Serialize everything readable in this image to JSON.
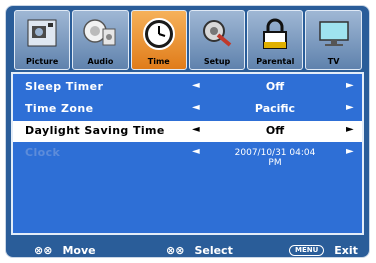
{
  "tabs": [
    {
      "label": "Picture",
      "icon": "picture-icon",
      "active": false
    },
    {
      "label": "Audio",
      "icon": "audio-icon",
      "active": false
    },
    {
      "label": "Time",
      "icon": "clock-icon",
      "active": true
    },
    {
      "label": "Setup",
      "icon": "setup-icon",
      "active": false
    },
    {
      "label": "Parental",
      "icon": "lock-icon",
      "active": false
    },
    {
      "label": "TV",
      "icon": "tv-icon",
      "active": false
    }
  ],
  "rows": [
    {
      "label": "Sleep Timer",
      "value": "Off",
      "left_arrow": "◄",
      "right_arrow": "►"
    },
    {
      "label": "Time Zone",
      "value": "Pacific",
      "left_arrow": "◄",
      "right_arrow": "►"
    },
    {
      "label": "Daylight Saving Time",
      "value": "Off",
      "left_arrow": "◄",
      "right_arrow": "►"
    },
    {
      "label": "Clock",
      "value": "2007/10/31 04:04 PM",
      "left_arrow": "◄",
      "right_arrow": "►"
    }
  ],
  "footer": {
    "move_icon": "⊗⊗",
    "move": "Move",
    "select_icon": "⊗⊗",
    "select": "Select",
    "menu_key": "MENU",
    "exit": "Exit"
  },
  "colors": {
    "frame": "#2a5d99",
    "panel": "#2e6fd6",
    "active_tab": "#e98f2a",
    "selected_row": "#ffffff",
    "disabled_text": "#5d8cda"
  }
}
